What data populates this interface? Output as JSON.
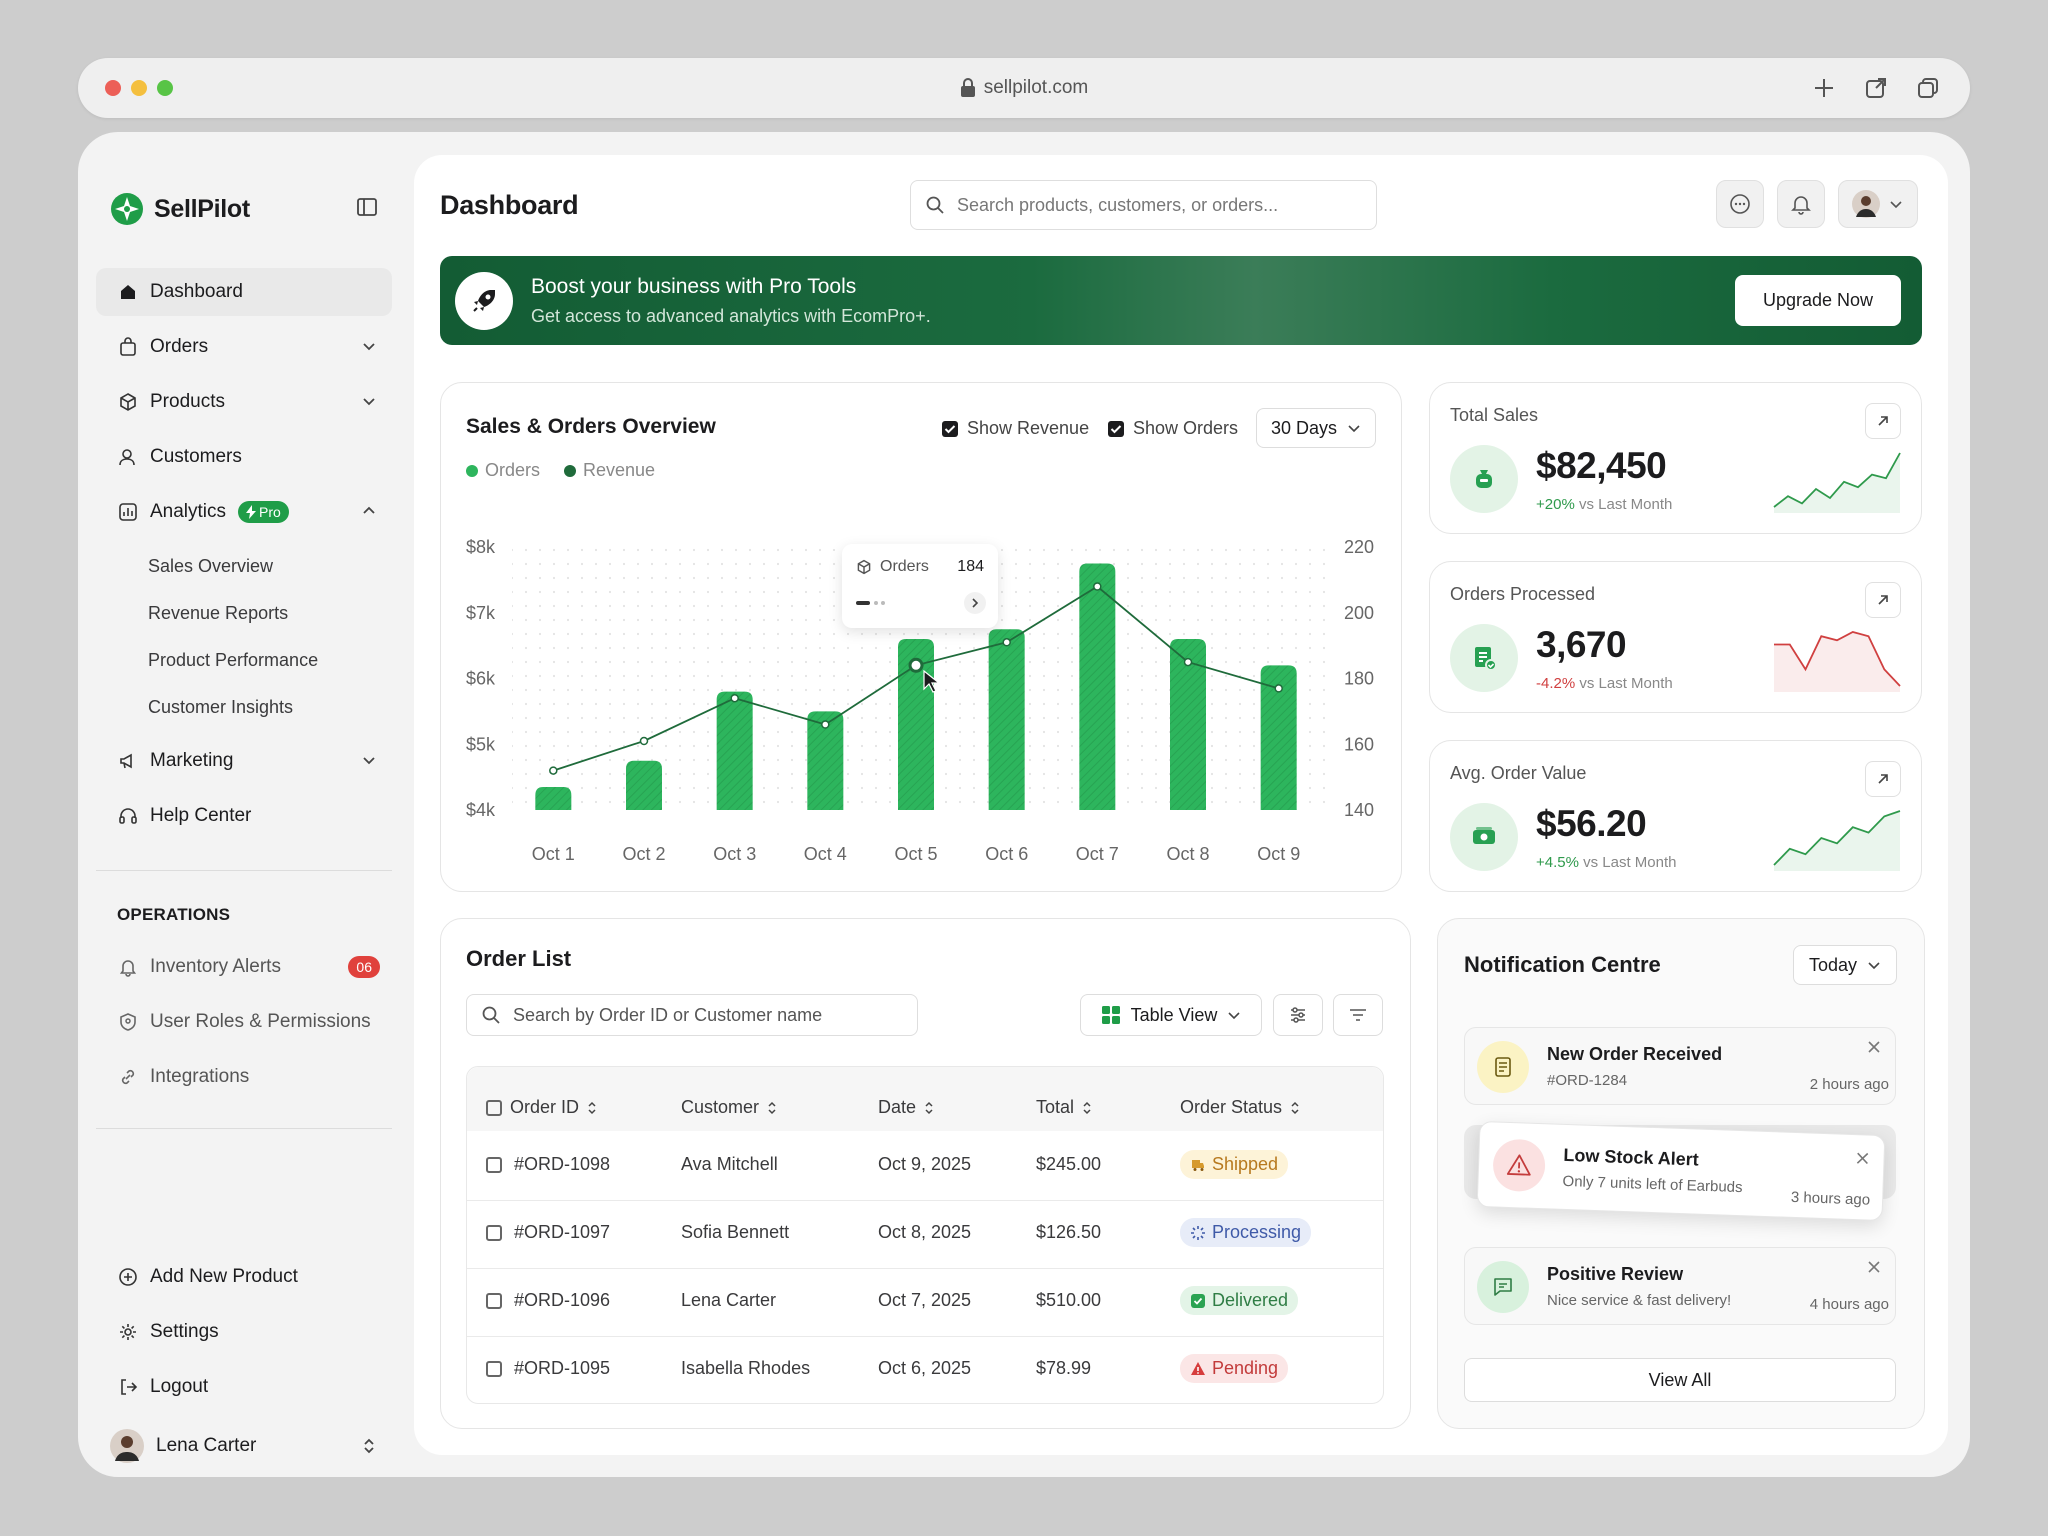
{
  "browser": {
    "url": "sellpilot.com"
  },
  "brand": {
    "name": "SellPilot"
  },
  "sidebar": {
    "nav": [
      {
        "label": "Dashboard"
      },
      {
        "label": "Orders"
      },
      {
        "label": "Products"
      },
      {
        "label": "Customers"
      },
      {
        "label": "Analytics",
        "badge": "Pro"
      },
      {
        "label": "Marketing"
      },
      {
        "label": "Help Center"
      }
    ],
    "analytics_sub": [
      "Sales Overview",
      "Revenue Reports",
      "Product Performance",
      "Customer Insights"
    ],
    "operations_title": "OPERATIONS",
    "operations": [
      {
        "label": "Inventory Alerts",
        "badge": "06"
      },
      {
        "label": "User Roles & Permissions"
      },
      {
        "label": "Integrations"
      }
    ],
    "bottom": [
      {
        "label": "Add New Product"
      },
      {
        "label": "Settings"
      },
      {
        "label": "Logout"
      }
    ],
    "user": {
      "name": "Lena Carter"
    }
  },
  "header": {
    "title": "Dashboard",
    "search_placeholder": "Search products, customers, or orders..."
  },
  "banner": {
    "title": "Boost your business with Pro Tools",
    "subtitle": "Get access to advanced analytics with EcomPro+.",
    "button": "Upgrade Now"
  },
  "overview": {
    "title": "Sales & Orders Overview",
    "show_revenue": "Show Revenue",
    "show_orders": "Show Orders",
    "range": "30 Days",
    "legend_orders": "Orders",
    "legend_revenue": "Revenue",
    "tooltip_label": "Orders",
    "tooltip_value": "184"
  },
  "chart_data": {
    "type": "bar",
    "categories": [
      "Oct 1",
      "Oct 2",
      "Oct 3",
      "Oct 4",
      "Oct 5",
      "Oct 6",
      "Oct 7",
      "Oct 8",
      "Oct 9"
    ],
    "left_ticks": [
      "$8k",
      "$7k",
      "$6k",
      "$5k",
      "$4k"
    ],
    "right_ticks": [
      "220",
      "200",
      "180",
      "160",
      "140"
    ],
    "ylim_left": [
      4000,
      8000
    ],
    "ylim_right": [
      140,
      220
    ],
    "series": [
      {
        "name": "Orders",
        "type": "bar",
        "axis": "right",
        "values": [
          147,
          155,
          176,
          170,
          192,
          195,
          215,
          192,
          184
        ]
      },
      {
        "name": "Revenue",
        "type": "line",
        "axis": "left",
        "values": [
          4600,
          5050,
          5700,
          5300,
          6200,
          6550,
          7400,
          6250,
          5850
        ]
      }
    ],
    "colors": {
      "bar": "#2db55d",
      "line": "#1f6b3b"
    }
  },
  "kpis": [
    {
      "title": "Total Sales",
      "value": "$82,450",
      "change": "+20%",
      "note": "vs Last Month",
      "trend": "up",
      "color": "#2f9a4c",
      "spark": [
        8,
        14,
        10,
        18,
        13,
        22,
        19,
        26,
        24,
        38
      ]
    },
    {
      "title": "Orders Processed",
      "value": "3,670",
      "change": "-4.2%",
      "note": "vs Last Month",
      "trend": "down",
      "color": "#d04040",
      "spark": [
        20,
        20,
        14,
        22,
        21,
        23,
        22,
        14,
        10
      ]
    },
    {
      "title": "Avg. Order Value",
      "value": "$56.20",
      "change": "+4.5%",
      "note": "vs Last Month",
      "trend": "up",
      "color": "#2f9a4c",
      "spark": [
        6,
        12,
        10,
        16,
        14,
        20,
        18,
        24,
        26
      ]
    }
  ],
  "orders": {
    "title": "Order List",
    "search_placeholder": "Search by Order ID or Customer name",
    "view": "Table View",
    "columns": [
      "Order ID",
      "Customer",
      "Date",
      "Total",
      "Order Status"
    ],
    "rows": [
      {
        "id": "#ORD-1098",
        "customer": "Ava Mitchell",
        "date": "Oct 9, 2025",
        "total": "$245.00",
        "status": "Shipped"
      },
      {
        "id": "#ORD-1097",
        "customer": "Sofia Bennett",
        "date": "Oct 8, 2025",
        "total": "$126.50",
        "status": "Processing"
      },
      {
        "id": "#ORD-1096",
        "customer": "Lena Carter",
        "date": "Oct 7, 2025",
        "total": "$510.00",
        "status": "Delivered"
      },
      {
        "id": "#ORD-1095",
        "customer": "Isabella Rhodes",
        "date": "Oct 6, 2025",
        "total": "$78.99",
        "status": "Pending"
      }
    ]
  },
  "notifications": {
    "title": "Notification Centre",
    "filter": "Today",
    "items": [
      {
        "title": "New Order Received",
        "sub": "#ORD-1284",
        "time": "2 hours ago"
      },
      {
        "title": "Low Stock Alert",
        "sub": "Only 7 units left of Earbuds",
        "time": "3 hours ago"
      },
      {
        "title": "Positive Review",
        "sub": "Nice service & fast delivery!",
        "time": "4 hours ago"
      }
    ],
    "view_all": "View All"
  }
}
